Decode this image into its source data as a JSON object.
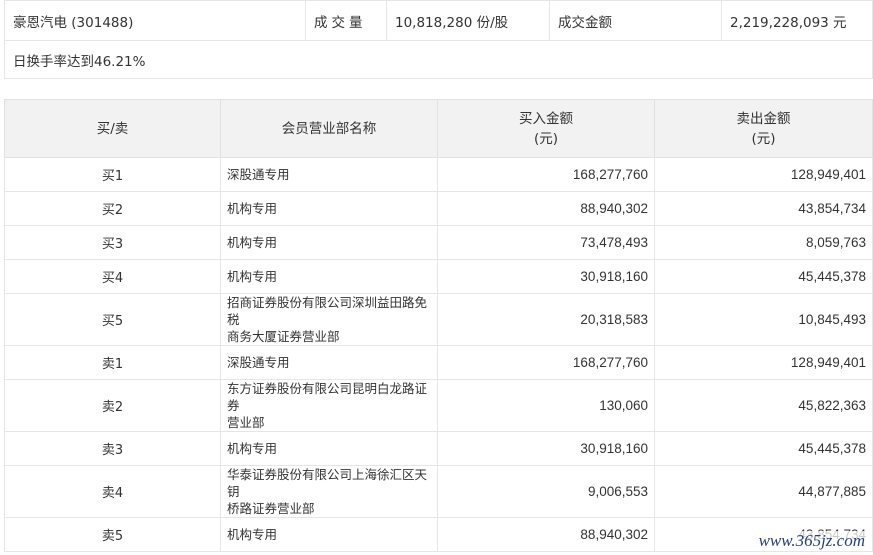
{
  "summary": {
    "stock": "豪恩汽电 (301488)",
    "volume_label": "成交量",
    "volume_value": "10,818,280 份/股",
    "amount_label": "成交金额",
    "amount_value": "2,219,228,093 元",
    "turnover_note": "日换手率达到46.21%"
  },
  "table": {
    "headers": {
      "side": "买/卖",
      "member": "会员营业部名称",
      "buy_line1": "买入金额",
      "buy_line2": "(元)",
      "sell_line1": "卖出金额",
      "sell_line2": "(元)"
    },
    "rows": [
      {
        "side": "买1",
        "name1": "深股通专用",
        "name2": "",
        "buy": "168,277,760",
        "sell": "128,949,401"
      },
      {
        "side": "买2",
        "name1": "机构专用",
        "name2": "",
        "buy": "88,940,302",
        "sell": "43,854,734"
      },
      {
        "side": "买3",
        "name1": "机构专用",
        "name2": "",
        "buy": "73,478,493",
        "sell": "8,059,763"
      },
      {
        "side": "买4",
        "name1": "机构专用",
        "name2": "",
        "buy": "30,918,160",
        "sell": "45,445,378"
      },
      {
        "side": "买5",
        "name1": "招商证券股份有限公司深圳益田路免税",
        "name2": "商务大厦证券营业部",
        "buy": "20,318,583",
        "sell": "10,845,493"
      },
      {
        "side": "卖1",
        "name1": "深股通专用",
        "name2": "",
        "buy": "168,277,760",
        "sell": "128,949,401"
      },
      {
        "side": "卖2",
        "name1": "东方证券股份有限公司昆明白龙路证券",
        "name2": "营业部",
        "buy": "130,060",
        "sell": "45,822,363"
      },
      {
        "side": "卖3",
        "name1": "机构专用",
        "name2": "",
        "buy": "30,918,160",
        "sell": "45,445,378"
      },
      {
        "side": "卖4",
        "name1": "华泰证券股份有限公司上海徐汇区天钥",
        "name2": "桥路证券营业部",
        "buy": "9,006,553",
        "sell": "44,877,885"
      },
      {
        "side": "卖5",
        "name1": "机构专用",
        "name2": "",
        "buy": "88,940,302",
        "sell": "43,854,734"
      }
    ]
  },
  "watermark": "www.365jz.com"
}
